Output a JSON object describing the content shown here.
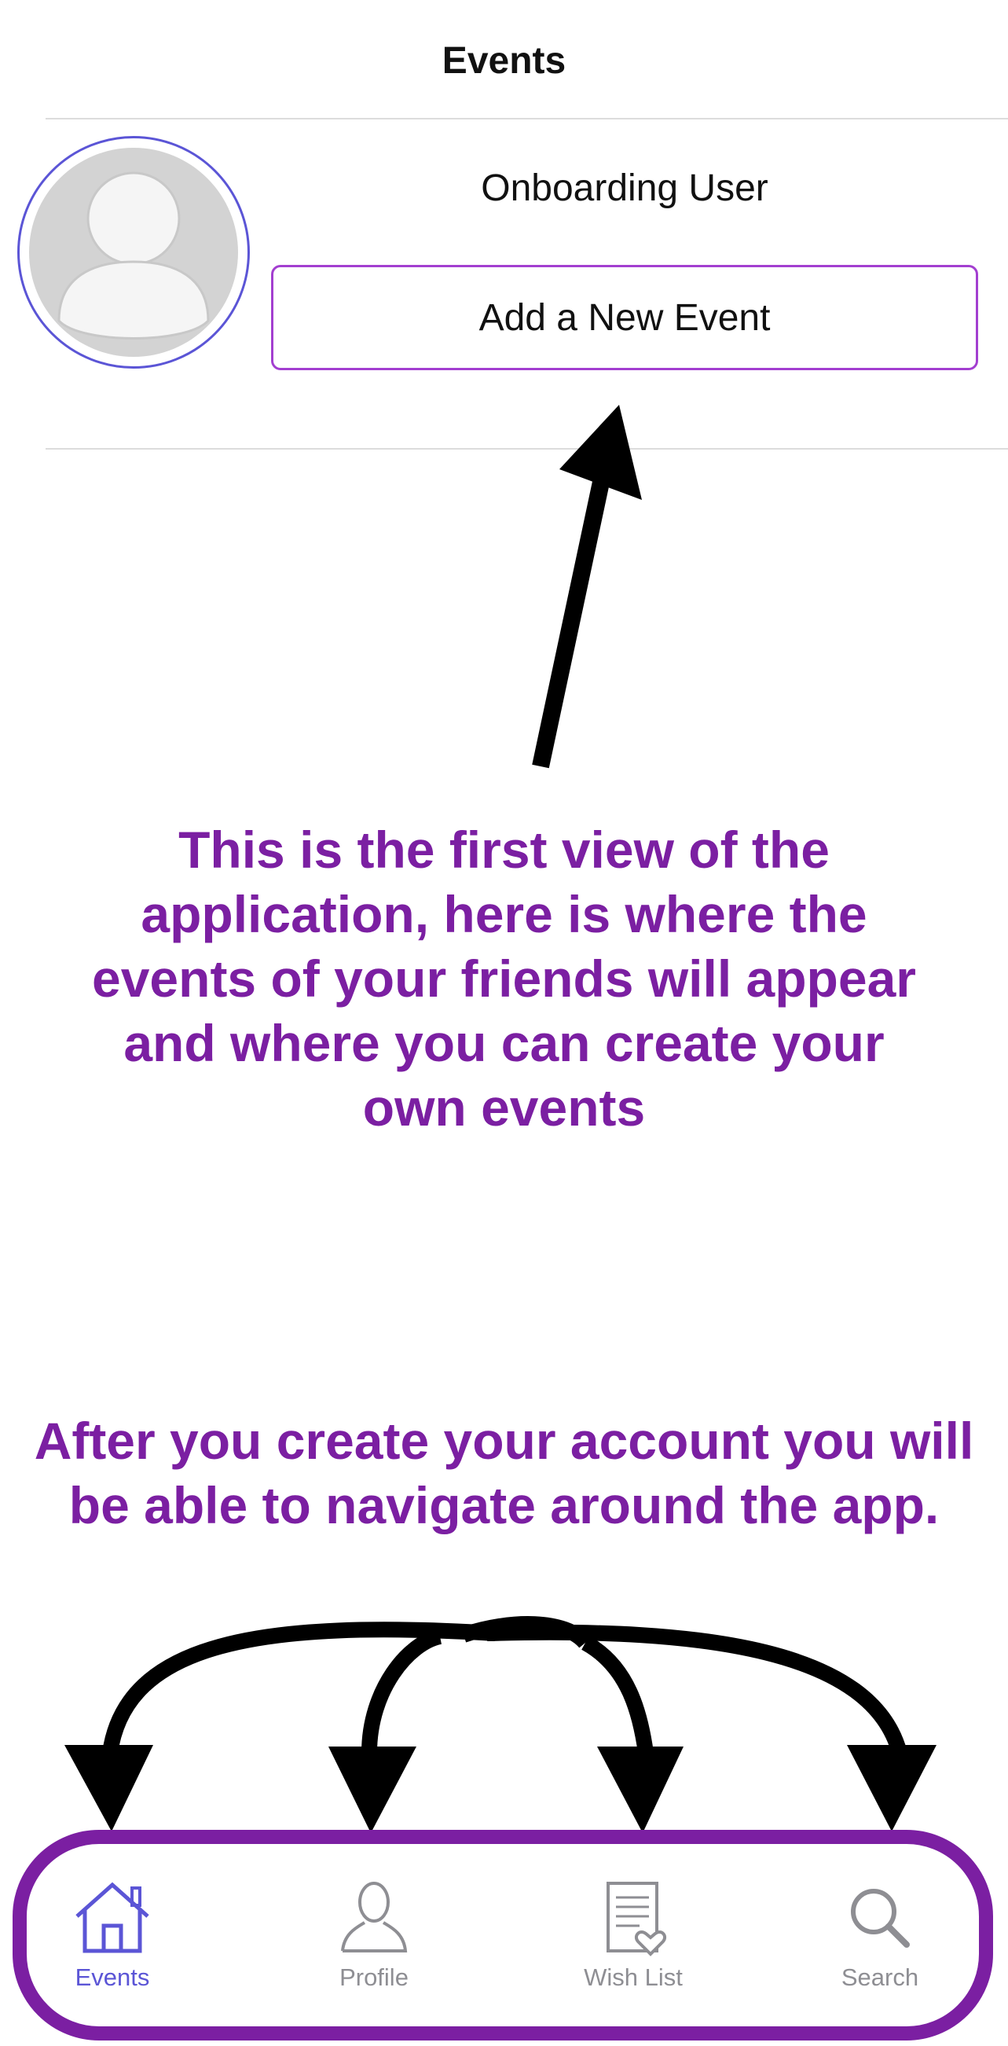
{
  "nav": {
    "title": "Events"
  },
  "user": {
    "name": "Onboarding User"
  },
  "actions": {
    "add_event_label": "Add a New Event"
  },
  "annotations": {
    "first_view": "This is the first view of the application, here is where the events of your friends will appear and where you can create your own events",
    "navigation": "After you create your account you will be able to navigate around the app."
  },
  "tabbar": {
    "tabs": [
      {
        "label": "Events",
        "icon": "house-icon",
        "active": true
      },
      {
        "label": "Profile",
        "icon": "person-icon",
        "active": false
      },
      {
        "label": "Wish List",
        "icon": "wishlist-icon",
        "active": false
      },
      {
        "label": "Search",
        "icon": "search-icon",
        "active": false
      }
    ]
  },
  "colors": {
    "accent": "#5b55d6",
    "annotation": "#7b1fa2",
    "button_border": "#a33fd0",
    "inactive_tab": "#8e8e93"
  }
}
